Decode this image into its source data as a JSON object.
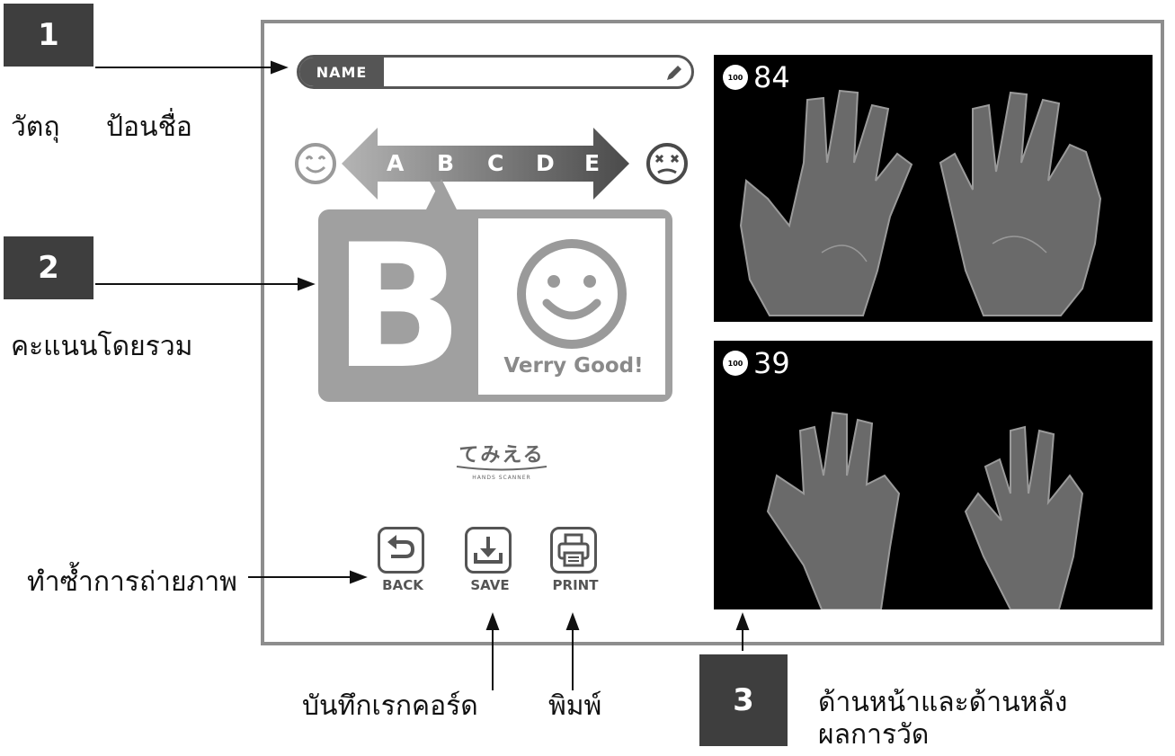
{
  "callouts": [
    {
      "number": "1",
      "label_a": "วัตถุ",
      "label_b": "ป้อนชื่อ"
    },
    {
      "number": "2",
      "label": "คะแนนโดยรวม"
    },
    {
      "number": "3",
      "label_line1": "ด้านหน้าและด้านหลัง",
      "label_line2": "ผลการวัด"
    }
  ],
  "side_labels": {
    "retake": "ทำซ้ำการถ่ายภาพ",
    "save_record": "บันทึกเรกคอร์ด",
    "print": "พิมพ์"
  },
  "screen": {
    "name_field": {
      "label": "NAME",
      "value": "",
      "edit_icon": "pencil-icon"
    },
    "grade_scale": {
      "grades": [
        "A",
        "B",
        "C",
        "D",
        "E"
      ],
      "selected": "B",
      "left_icon": "happy-face-icon",
      "right_icon": "dizzy-face-icon"
    },
    "result": {
      "grade": "B",
      "face_icon": "smile-icon",
      "comment": "Verry Good!"
    },
    "logo": {
      "main": "てみえる",
      "sub": "HANDS SCANNER"
    },
    "buttons": [
      {
        "label": "BACK",
        "icon": "back-arrow-icon"
      },
      {
        "label": "SAVE",
        "icon": "download-icon"
      },
      {
        "label": "PRINT",
        "icon": "printer-icon"
      }
    ],
    "photos": [
      {
        "score_badge": "100",
        "score": "84",
        "view": "palms"
      },
      {
        "score_badge": "100",
        "score": "39",
        "view": "backs"
      }
    ]
  },
  "colors": {
    "frame": "#8d8d8d",
    "dark": "#3e3e3e",
    "grade_gray": "#a0a0a0",
    "photo_bg": "#000000"
  }
}
